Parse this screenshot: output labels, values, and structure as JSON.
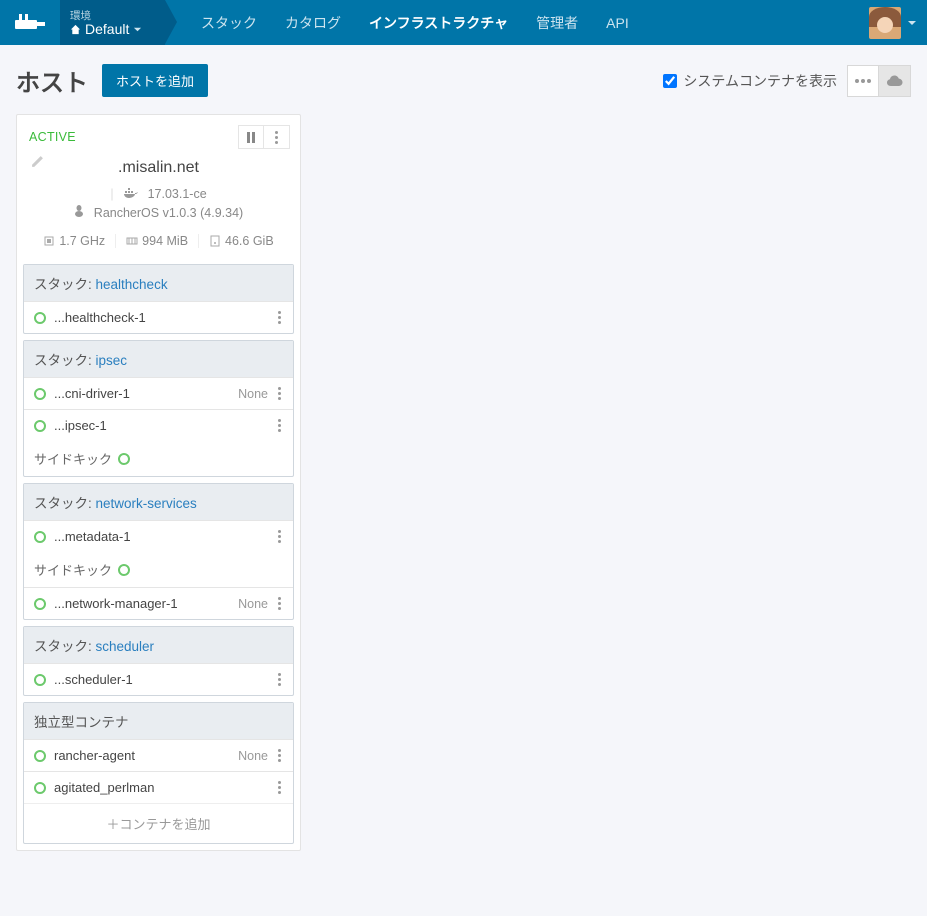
{
  "header": {
    "env_label": "環境",
    "env_value": "Default",
    "nav": [
      "スタック",
      "カタログ",
      "インフラストラクチャ",
      "管理者",
      "API"
    ],
    "active_nav_index": 2
  },
  "page": {
    "title": "ホスト",
    "add_host_button": "ホストを追加",
    "system_containers_label": "システムコンテナを表示",
    "system_containers_checked": true
  },
  "host": {
    "status": "ACTIVE",
    "name": ".misalin.net",
    "docker_version": "17.03.1-ce",
    "os_info": "RancherOS v1.0.3 (4.9.34)",
    "cpu": "1.7 GHz",
    "memory": "994 MiB",
    "storage": "46.6 GiB",
    "stack_label": "スタック",
    "sidekick_label": "サイドキック",
    "standalone_label": "独立型コンテナ",
    "add_container_label": "コンテナを追加",
    "none_label": "None",
    "stacks": [
      {
        "name": "healthcheck",
        "services": [
          {
            "name": "...healthcheck-1",
            "right": ""
          }
        ],
        "sidekick": false
      },
      {
        "name": "ipsec",
        "services": [
          {
            "name": "...cni-driver-1",
            "right": "None"
          },
          {
            "name": "...ipsec-1",
            "right": ""
          }
        ],
        "sidekick": true
      },
      {
        "name": "network-services",
        "services_a": [
          {
            "name": "...metadata-1",
            "right": ""
          }
        ],
        "sidekick": true,
        "services_b": [
          {
            "name": "...network-manager-1",
            "right": "None"
          }
        ]
      },
      {
        "name": "scheduler",
        "services": [
          {
            "name": "...scheduler-1",
            "right": ""
          }
        ],
        "sidekick": false
      }
    ],
    "standalone": [
      {
        "name": "rancher-agent",
        "right": "None"
      },
      {
        "name": "agitated_perlman",
        "right": ""
      }
    ]
  }
}
